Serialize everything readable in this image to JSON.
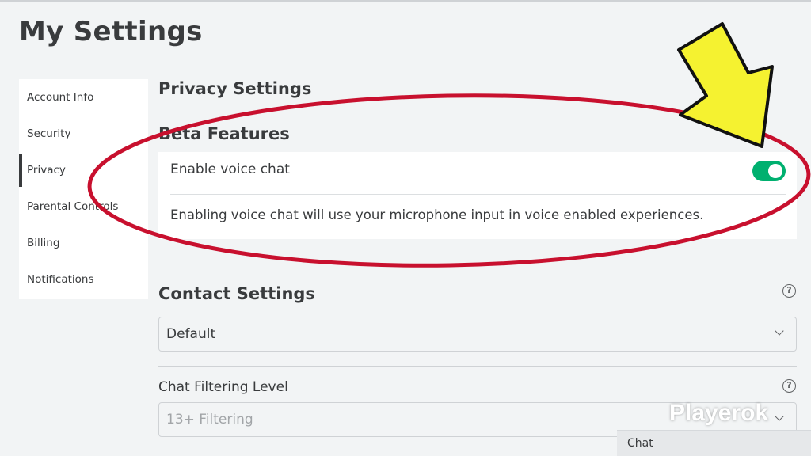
{
  "page": {
    "title": "My Settings"
  },
  "sidebar": {
    "items": [
      {
        "label": "Account Info"
      },
      {
        "label": "Security"
      },
      {
        "label": "Privacy",
        "active": true
      },
      {
        "label": "Parental Controls"
      },
      {
        "label": "Billing"
      },
      {
        "label": "Notifications"
      }
    ]
  },
  "privacy": {
    "title": "Privacy Settings",
    "beta": {
      "title": "Beta Features",
      "voice_chat_label": "Enable voice chat",
      "voice_chat_enabled": true,
      "voice_chat_description": "Enabling voice chat will use your microphone input in voice enabled experiences."
    },
    "contact": {
      "title": "Contact Settings",
      "help_icon": "question-circle-icon",
      "selected": "Default"
    },
    "chat_filter": {
      "label": "Chat Filtering Level",
      "help_icon": "question-circle-icon",
      "selected": "13+ Filtering"
    }
  },
  "chat": {
    "label": "Chat"
  },
  "watermark": {
    "text": "Playerok"
  },
  "colors": {
    "background": "#f2f4f5",
    "toggle_on": "#00b06f",
    "annotation_circle": "#c8102e",
    "annotation_arrow": "#f5f230"
  },
  "annotations": {
    "circle": "red-ellipse-highlight",
    "arrow": "yellow-arrow-pointer"
  }
}
